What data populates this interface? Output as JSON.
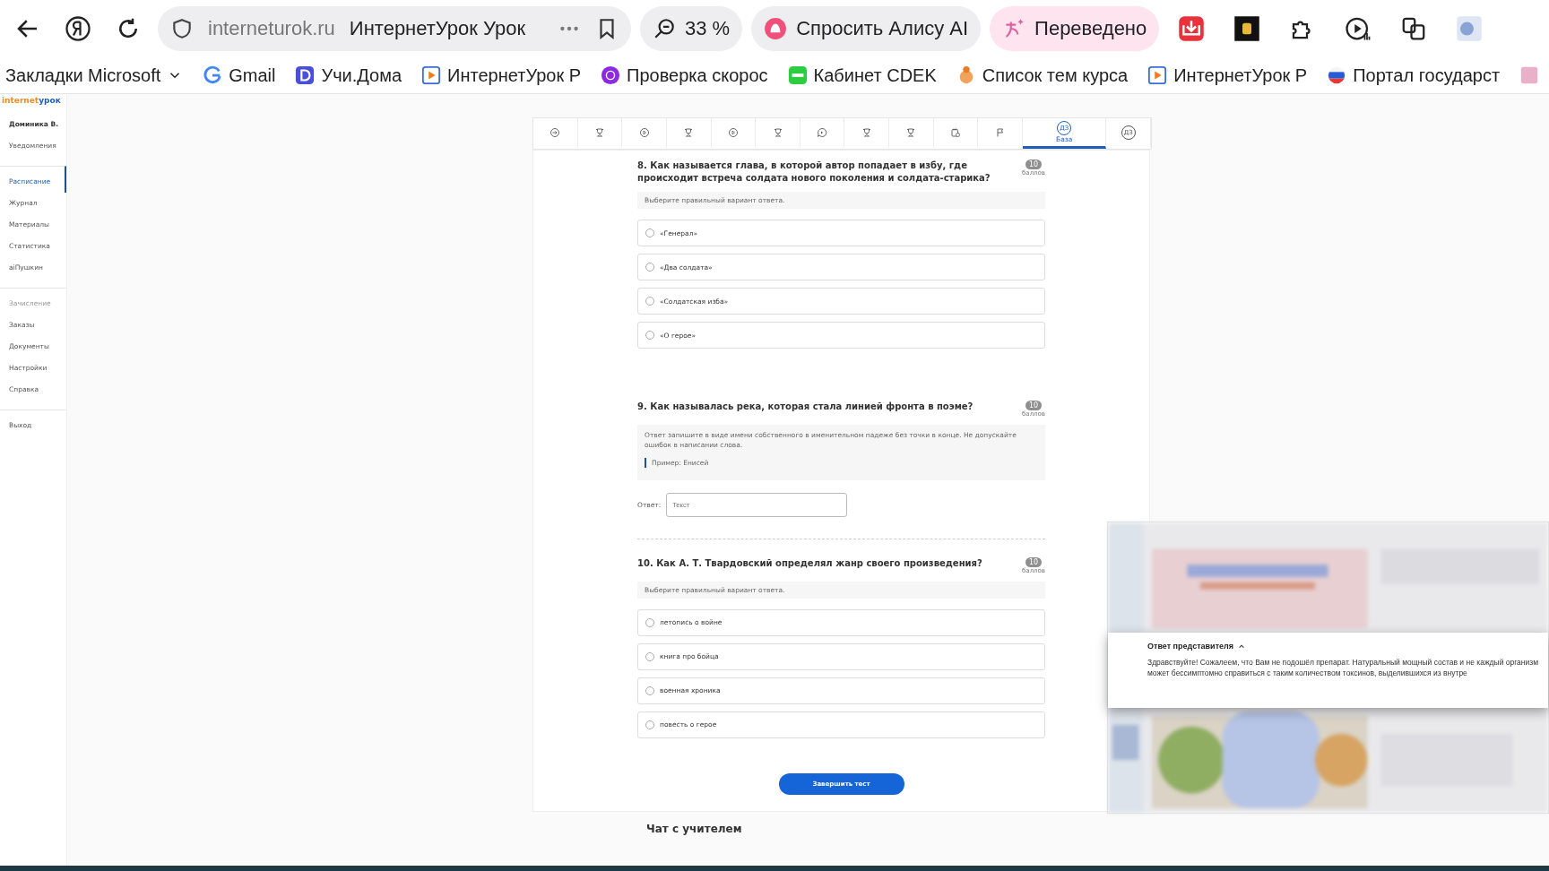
{
  "browser": {
    "address": {
      "domain": "interneturok.ru",
      "title": "ИнтернетУрок Урок"
    },
    "zoom": "33 %",
    "alice": "Спросить Алису AI",
    "translate": "Переведено",
    "bookmarks": [
      {
        "label": "Закладки Microsoft",
        "kind": "folder"
      },
      {
        "label": "Gmail",
        "kind": "g"
      },
      {
        "label": "Учи.Дома",
        "kind": "d"
      },
      {
        "label": "ИнтернетУрок Р",
        "kind": "play"
      },
      {
        "label": "Проверка скорос",
        "kind": "speed"
      },
      {
        "label": "Кабинет CDEK",
        "kind": "cdek"
      },
      {
        "label": "Список тем курса",
        "kind": "list"
      },
      {
        "label": "ИнтернетУрок Р",
        "kind": "play"
      },
      {
        "label": "Портал государст",
        "kind": "flag"
      }
    ]
  },
  "logo": {
    "part_1": "internet",
    "part_2": "урок"
  },
  "sidebar": {
    "items": [
      {
        "label": "Доминика В.",
        "kind": "user",
        "selected": false,
        "disabled": false
      },
      {
        "label": "Уведомления",
        "kind": "item",
        "selected": false,
        "disabled": false
      },
      {
        "label": "Расписание",
        "kind": "item",
        "selected": true,
        "disabled": false,
        "group_start": true
      },
      {
        "label": "Журнал",
        "kind": "item",
        "selected": false,
        "disabled": false
      },
      {
        "label": "Материалы",
        "kind": "item",
        "selected": false,
        "disabled": false
      },
      {
        "label": "Статистика",
        "kind": "item",
        "selected": false,
        "disabled": false
      },
      {
        "label": "aiПушкин",
        "kind": "item",
        "selected": false,
        "disabled": false
      },
      {
        "label": "Зачисление",
        "kind": "item",
        "selected": false,
        "disabled": true,
        "group_start": true
      },
      {
        "label": "Заказы",
        "kind": "item",
        "selected": false,
        "disabled": false
      },
      {
        "label": "Документы",
        "kind": "item",
        "selected": false,
        "disabled": false
      },
      {
        "label": "Настройки",
        "kind": "item",
        "selected": false,
        "disabled": false
      },
      {
        "label": "Справка",
        "kind": "item",
        "selected": false,
        "disabled": false
      },
      {
        "label": "Выход",
        "kind": "item",
        "selected": false,
        "disabled": false,
        "group_start": true
      }
    ]
  },
  "steps": [
    {
      "kind": "arrow",
      "selected": false
    },
    {
      "kind": "trophy",
      "selected": false
    },
    {
      "kind": "play",
      "selected": false
    },
    {
      "kind": "trophy",
      "selected": false
    },
    {
      "kind": "play",
      "selected": false
    },
    {
      "kind": "trophy",
      "selected": false
    },
    {
      "kind": "chat",
      "selected": false
    },
    {
      "kind": "trophy",
      "selected": false
    },
    {
      "kind": "trophy",
      "selected": false
    },
    {
      "kind": "calendar",
      "selected": false
    },
    {
      "kind": "flag",
      "selected": false
    },
    {
      "kind": "homework",
      "icon_text": "ДЗ",
      "label": "База",
      "selected": true
    },
    {
      "kind": "homework",
      "icon_text": "ДЗ",
      "selected": false
    }
  ],
  "questions": [
    {
      "kind": "choice",
      "title": "8. Как называется глава, в которой автор попадает в избу, где происходит встреча солдата нового поколения и солдата-старика?",
      "points": "10",
      "points_label": "баллов",
      "hint": "Выберите правильный вариант ответа.",
      "options": [
        {
          "label": "«Генерал»",
          "selected": false
        },
        {
          "label": "«Два солдата»",
          "selected": false
        },
        {
          "label": "«Солдатская изба»",
          "selected": false
        },
        {
          "label": "«О герое»",
          "selected": false
        }
      ]
    },
    {
      "kind": "text",
      "title": "9. Как называлась река, которая стала линией фронта в поэме?",
      "points": "10",
      "points_label": "баллов",
      "hint": "Ответ запишите в виде имени собственного в именительном падеже без точки в конце. Не допускайте ошибок в написании слова.",
      "example": "Пример: Енисей",
      "answer_label": "Ответ:",
      "placeholder": "Текст"
    },
    {
      "kind": "choice",
      "title": "10. Как А. Т. Твардовский определял жанр своего произведения?",
      "points": "10",
      "points_label": "баллов",
      "hint": "Выберите правильный вариант ответа.",
      "options": [
        {
          "label": "летопись о войне",
          "selected": false
        },
        {
          "label": "книга про бойца",
          "selected": false
        },
        {
          "label": "военная хроника",
          "selected": false
        },
        {
          "label": "повесть о герое",
          "selected": false
        }
      ]
    }
  ],
  "finish_button": "Завершить тест",
  "chat_title": "Чат с учителем",
  "overlay": {
    "kind": "picture",
    "popup": {
      "title": "Ответ представителя",
      "expanded": true,
      "text": "Здравствуйте! Сожалеем, что Вам не подошёл препарат. Натуральный мощный состав и не каждый организм может бессимптомно справиться с таким количеством токсинов, выделившихся из внутре"
    }
  }
}
